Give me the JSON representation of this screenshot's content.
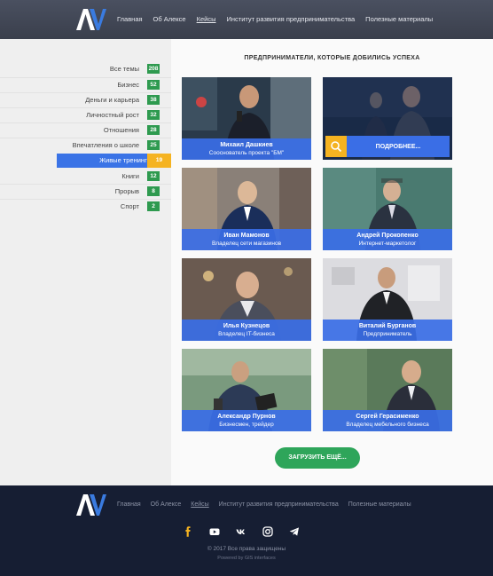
{
  "header": {
    "logo_text": "AV",
    "nav": [
      "Главная",
      "Об Алексе",
      "Кейсы",
      "Институт развития предпринимательства",
      "Полезные материалы"
    ],
    "active_nav": "Кейсы"
  },
  "sidebar": {
    "items": [
      {
        "label": "Все темы",
        "count": "208"
      },
      {
        "label": "Бизнес",
        "count": "52"
      },
      {
        "label": "Деньги и карьера",
        "count": "38"
      },
      {
        "label": "Личностный рост",
        "count": "32"
      },
      {
        "label": "Отношения",
        "count": "28"
      },
      {
        "label": "Впечатления о школе",
        "count": "25"
      },
      {
        "label": "Живые тренинги",
        "count": "19",
        "selected": true
      },
      {
        "label": "Книги",
        "count": "12"
      },
      {
        "label": "Прорыв",
        "count": "8"
      },
      {
        "label": "Спорт",
        "count": "2"
      }
    ]
  },
  "main": {
    "title": "ПРЕДПРИНИМАТЕЛИ, КОТОРЫЕ ДОБИЛИСЬ УСПЕХА",
    "cards": [
      {
        "name": "Михаил Дашкиев",
        "role": "Сооснователь проекта \"БМ\""
      },
      {
        "more_label": "ПОДРОБНЕЕ..."
      },
      {
        "name": "Иван Мамонов",
        "role": "Владелец сети магазинов"
      },
      {
        "name": "Андрей Прокопенко",
        "role": "Интернет-маркетолог"
      },
      {
        "name": "Илья Кузнецов",
        "role": "Владелец IT-бизнеса"
      },
      {
        "name": "Виталий Бурганов",
        "role": "Предприниматель"
      },
      {
        "name": "Александр Пурнов",
        "role": "Бизнесмен, трейдер"
      },
      {
        "name": "Сергей Герасименко",
        "role": "Владелец мебельного бизнеса"
      }
    ],
    "load_more_label": "ЗАГРУЗИТЬ ЕЩЁ..."
  },
  "footer": {
    "logo_text": "AV",
    "nav": [
      "Главная",
      "Об Алексе",
      "Кейсы",
      "Институт развития предпринимательства",
      "Полезные материалы"
    ],
    "active_nav": "Кейсы",
    "socials": [
      "facebook-icon",
      "youtube-icon",
      "vk-icon",
      "instagram-icon",
      "telegram-icon"
    ],
    "copyright": "© 2017 Все права защищены",
    "powered": "Powered by GIS interfaces"
  },
  "colors": {
    "accent_blue": "#3a6ee6",
    "accent_yellow": "#f5b321",
    "badge_green": "#2e9a4f",
    "footer_bg": "#161e33"
  }
}
